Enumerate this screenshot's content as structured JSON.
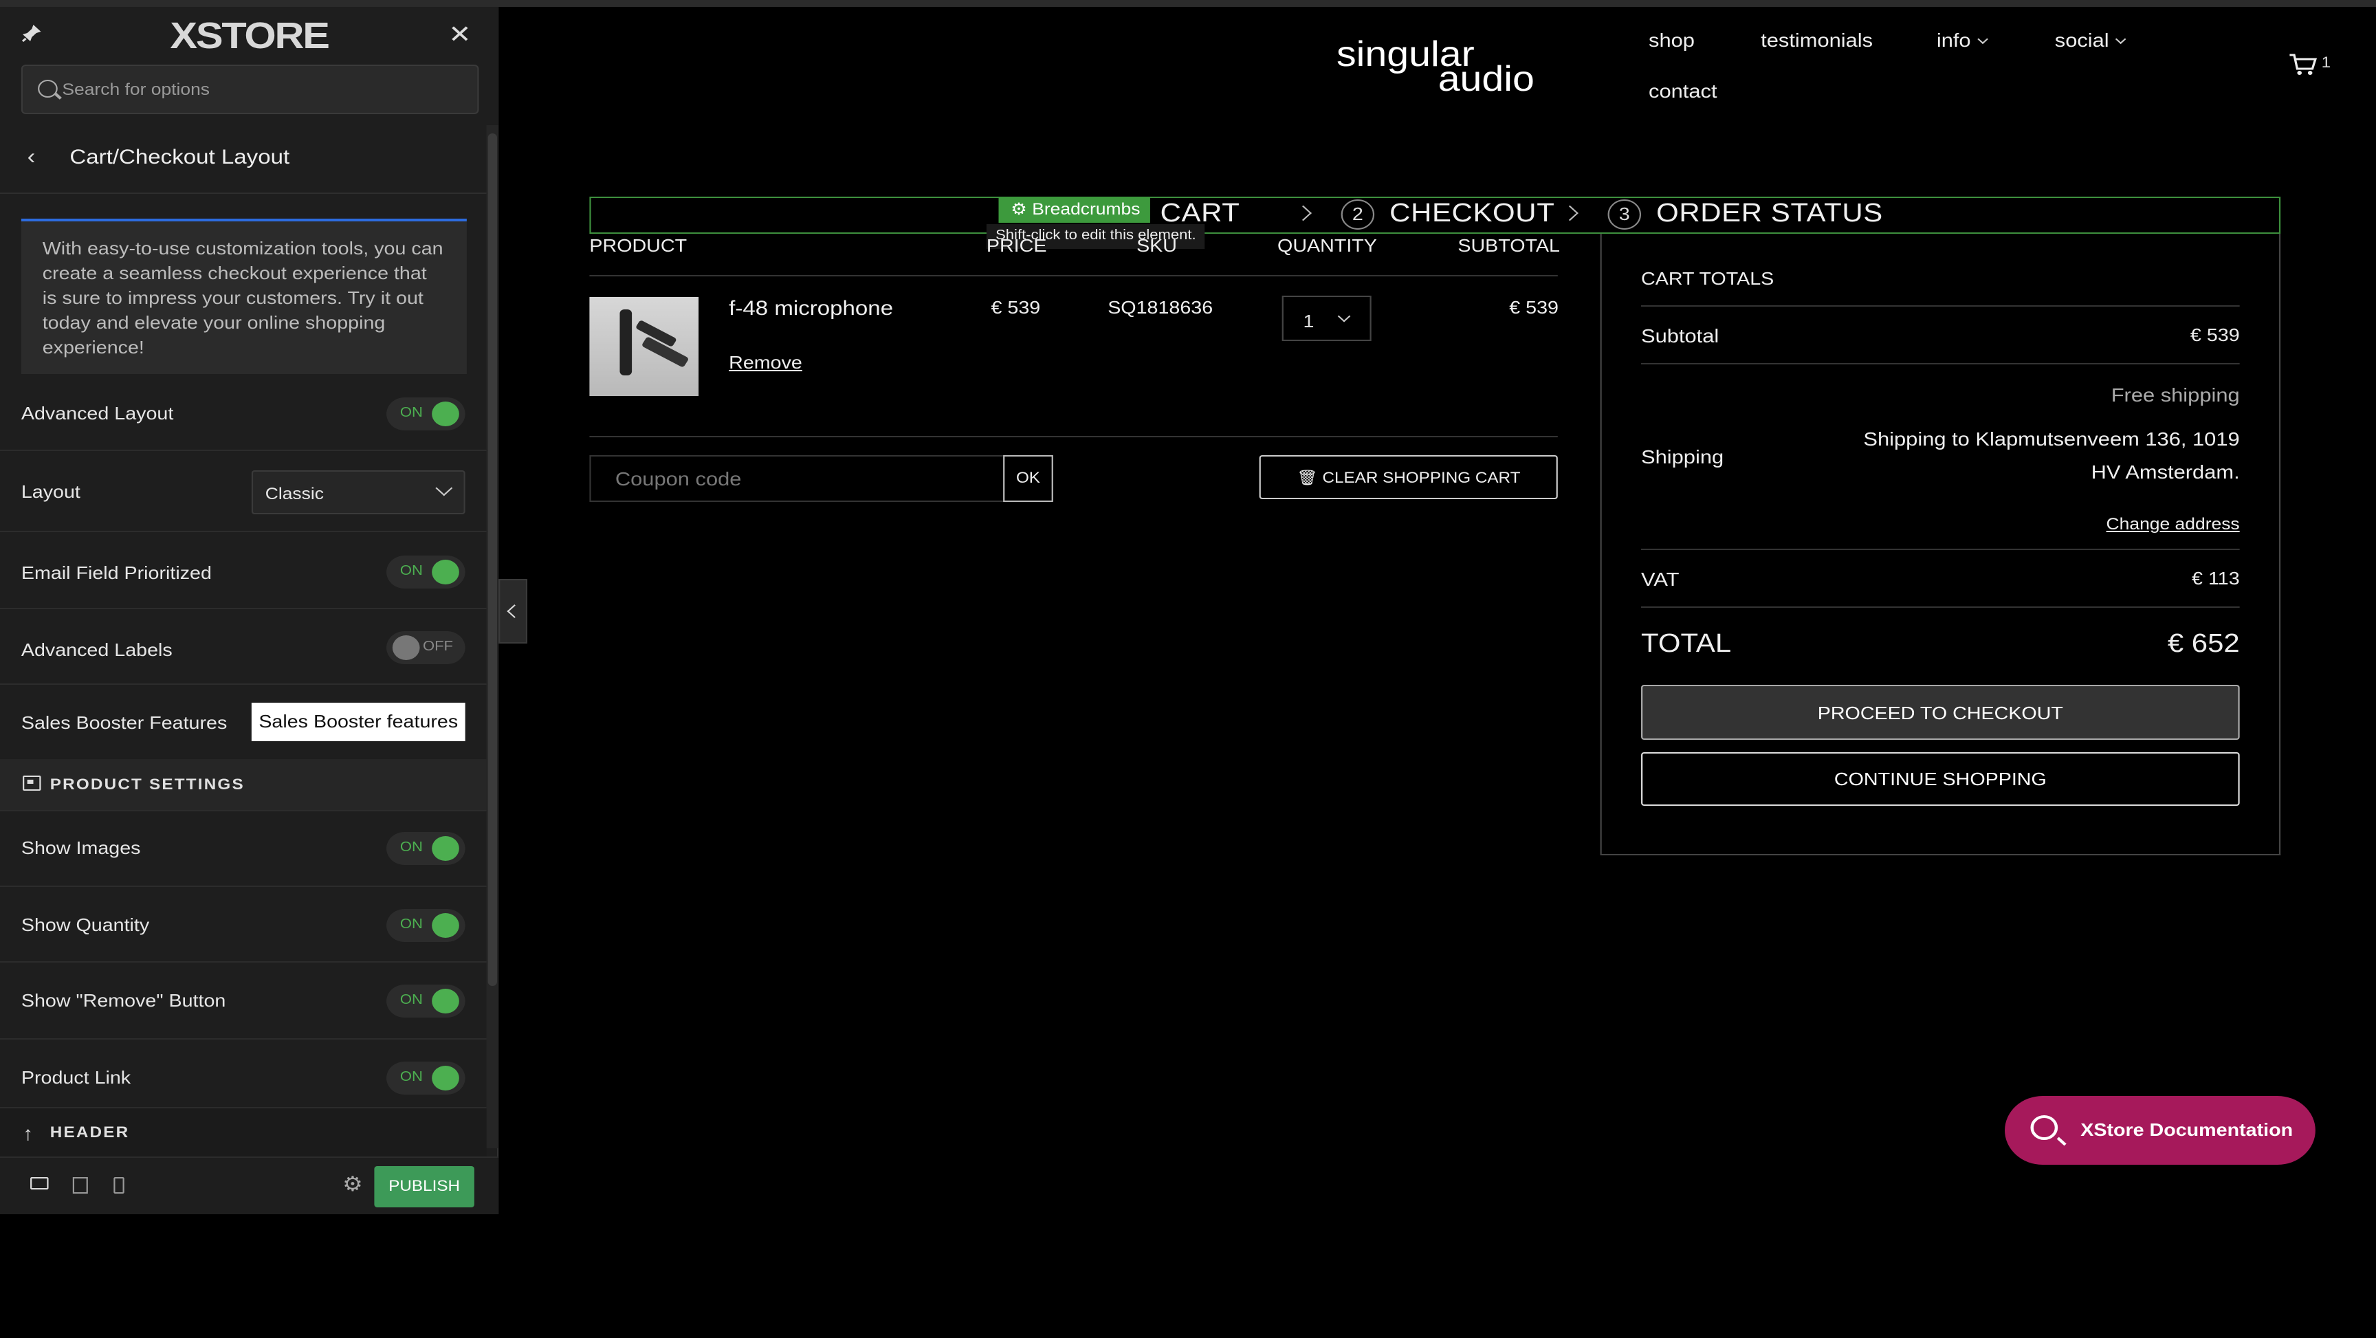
{
  "customizer": {
    "logo": "XSTORE",
    "search_placeholder": "Search for options",
    "panel_title": "Cart/Checkout Layout",
    "description": "With easy-to-use customization tools, you can create a seamless checkout experience that is sure to impress your customers. Try it out today and elevate your online shopping experience!",
    "options": [
      {
        "label": "Advanced Layout",
        "state": "ON"
      },
      {
        "label": "Layout",
        "value": "Classic"
      },
      {
        "label": "Email Field Prioritized",
        "state": "ON"
      },
      {
        "label": "Advanced Labels",
        "state": "OFF"
      },
      {
        "label": "Sales Booster Features",
        "button": "Sales Booster features"
      }
    ],
    "product_settings": {
      "title": "PRODUCT SETTINGS",
      "items": [
        {
          "label": "Show Images",
          "state": "ON"
        },
        {
          "label": "Show Quantity",
          "state": "ON"
        },
        {
          "label": "Show \"Remove\" Button",
          "state": "ON"
        },
        {
          "label": "Product Link",
          "state": "ON"
        }
      ]
    },
    "header_section": "HEADER",
    "publish_label": "PUBLISH"
  },
  "site": {
    "logo_line1": "singular",
    "logo_line2": "audio",
    "nav": [
      "shop",
      "testimonials",
      "info",
      "social",
      "contact"
    ],
    "cart_count": "1"
  },
  "breadcrumbs": {
    "tag": "Breadcrumbs",
    "tooltip": "Shift-click to edit this element.",
    "step1": "NG CART",
    "step2_num": "2",
    "step2": "CHECKOUT",
    "step3_num": "3",
    "step3": "ORDER STATUS"
  },
  "cart_table": {
    "headers": [
      "PRODUCT",
      "PRICE",
      "SKU",
      "QUANTITY",
      "SUBTOTAL"
    ],
    "visible_headers": {
      "price": "PRICE",
      "sku": "SKU"
    },
    "rows": [
      {
        "name": "f-48 microphone",
        "remove": "Remove",
        "price": "€ 539",
        "sku": "SQ1818636",
        "quantity": "1",
        "subtotal": "€ 539"
      }
    ],
    "coupon_placeholder": "Coupon code",
    "ok_label": "OK",
    "clear_label": "CLEAR SHOPPING CART"
  },
  "totals": {
    "title": "CART TOTALS",
    "subtotal_label": "Subtotal",
    "subtotal_value": "€ 539",
    "shipping_label": "Shipping",
    "shipping_method": "Free shipping",
    "shipping_line1": "Shipping to Klapmutsenveem 136, 1019",
    "shipping_line2": "HV Amsterdam.",
    "change_address": "Change address",
    "vat_label": "VAT",
    "vat_value": "€ 113",
    "total_label": "TOTAL",
    "total_value": "€ 652",
    "proceed_label": "PROCEED TO CHECKOUT",
    "continue_label": "CONTINUE SHOPPING"
  },
  "docs_button": "XStore Documentation",
  "colors": {
    "toggle_on": "#4caf50",
    "publish": "#3d9a58",
    "docs": "#a6195b",
    "breadcrumb_outline": "#3d8f3d"
  }
}
